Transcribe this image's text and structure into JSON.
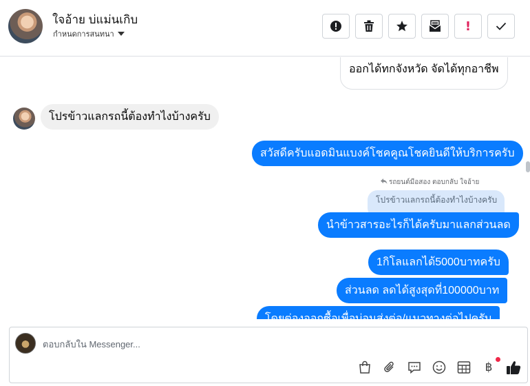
{
  "header": {
    "name": "ใจอ้าย บ่แม่นเกิบ",
    "assign_label": "กำหนดการสนทนา",
    "actions": [
      "info-icon",
      "trash-icon",
      "star-icon",
      "mail-icon",
      "alert-icon",
      "check-icon"
    ],
    "alert_glyph": "!"
  },
  "messages": {
    "m1": "ออกได้ทกจังหวัด จัดได้ทุกอาชีพ",
    "m2": "โปรข้าวแลกรถนี้ต้องทำไงบ้างครับ",
    "m3": "สวัสดีครับแอดมินแบงค์โชคคูณโชคยินดีให้บริการครับ",
    "reply_label": "รถยนต์มือสอง ตอบกลับ ใจอ้าย",
    "quoted": "โปรข้าวแลกรถนี้ต้องทำไงบ้างครับ",
    "m4": "นำข้าวสารอะไรก็ได้ครับมาแลกส่วนลด",
    "m5": "1กิโลแลกได้5000บาทครับ",
    "m6": "ส่วนลด ลดได้สูงสุดที่100000บาท",
    "m7": "โดยต่องออกซื้อเพื่อบ่อนส่งต่อ/แนวทางต่อไปครับ"
  },
  "composer": {
    "placeholder": "ตอบกลับใน Messenger...",
    "tools": [
      "bag-icon",
      "paperclip-icon",
      "chat-bubble-icon",
      "emoji-icon",
      "table-icon",
      "baht-icon",
      "thumbs-up-icon"
    ],
    "baht_glyph": "฿"
  },
  "colors": {
    "outgoing": "#0a7cff",
    "incoming_grey": "#f0f0f0",
    "quote": "#d9e8fb",
    "notify_dot": "#f02849"
  }
}
